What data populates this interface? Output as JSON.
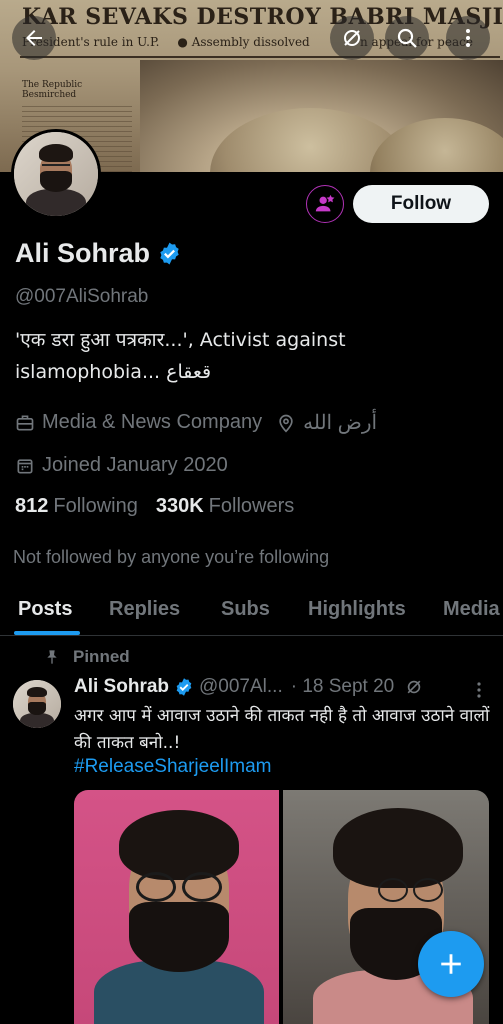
{
  "banner": {
    "headline": "KAR SEVAKS DESTROY BABRI MASJID",
    "subline_1": "President's rule in U.P.",
    "subline_2": "● Assembly dissolved",
    "subline_3": "n appeal for peace",
    "column_title": "The Republic Besmirched"
  },
  "topbar": {
    "back_icon": "arrow-left-icon",
    "mute_icon": "notifications-off-icon",
    "search_icon": "search-icon",
    "more_icon": "more-vertical-icon"
  },
  "profile": {
    "name": "Ali Sohrab",
    "handle": "@007AliSohrab",
    "bio_line_1": "'एक डरा हुआ पत्रकार...', Activist against",
    "bio_line_2": "islamophobia... قعقاع",
    "category": "Media & News Company",
    "location": "أرض الله",
    "joined": "Joined January 2020",
    "following_count": "812",
    "following_label": "Following",
    "followers_count": "330K",
    "followers_label": "Followers",
    "not_followed": "Not followed by anyone you’re following",
    "follow_label": "Follow"
  },
  "tabs": [
    {
      "label": "Posts",
      "active": true
    },
    {
      "label": "Replies",
      "active": false
    },
    {
      "label": "Subs",
      "active": false
    },
    {
      "label": "Highlights",
      "active": false
    },
    {
      "label": "Media",
      "active": false
    }
  ],
  "post": {
    "pinned_label": "Pinned",
    "author": "Ali Sohrab",
    "handle": "@007Al...",
    "date": "· 18 Sept 20",
    "text": "अगर आप में आवाज उठाने की ताकत नही है तो आवाज उठाने वालों की ताकत बनो..!",
    "hashtag": "#ReleaseSharjeelImam"
  },
  "colors": {
    "accent": "#1d9bf0",
    "background": "#000000",
    "secondary_text": "#71767b",
    "subscribe_ring": "#b032b6"
  }
}
